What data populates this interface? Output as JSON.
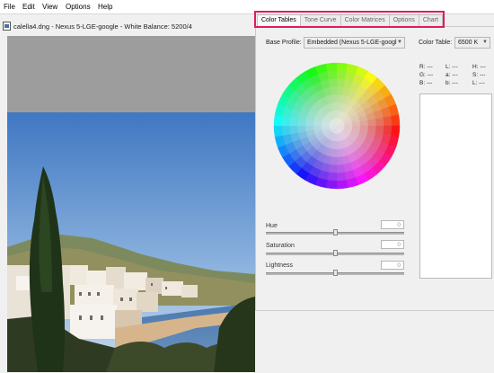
{
  "menubar": {
    "items": [
      "File",
      "Edit",
      "View",
      "Options",
      "Help"
    ]
  },
  "document": {
    "title": "calella4.dng  -  Nexus 5-LGE-google  -  White Balance: 5200/4"
  },
  "tabs": [
    {
      "label": "Color Tables",
      "active": true
    },
    {
      "label": "Tone Curve",
      "active": false
    },
    {
      "label": "Color Matrices",
      "active": false
    },
    {
      "label": "Options",
      "active": false
    },
    {
      "label": "Chart",
      "active": false
    }
  ],
  "color_tables": {
    "base_profile_label": "Base Profile:",
    "base_profile_value": "Embedded (Nexus 5-LGE-googl",
    "color_table_label": "Color Table:",
    "color_table_value": "6500 K",
    "readouts": {
      "col1": [
        {
          "label": "R:",
          "value": "---"
        },
        {
          "label": "G:",
          "value": "---"
        },
        {
          "label": "B:",
          "value": "---"
        }
      ],
      "col2": [
        {
          "label": "L:",
          "value": "---"
        },
        {
          "label": "a:",
          "value": "---"
        },
        {
          "label": "b:",
          "value": "---"
        }
      ],
      "col3": [
        {
          "label": "H:",
          "value": "---"
        },
        {
          "label": "S:",
          "value": "---"
        },
        {
          "label": "L:",
          "value": "---"
        }
      ]
    },
    "sliders": [
      {
        "label": "Hue",
        "value": "0"
      },
      {
        "label": "Saturation",
        "value": "0"
      },
      {
        "label": "Lightness",
        "value": "0"
      }
    ]
  },
  "colors": {
    "highlight": "#e31a5b",
    "panel_bg": "#f0f0f0",
    "workspace_gray": "#9d9d9d"
  }
}
